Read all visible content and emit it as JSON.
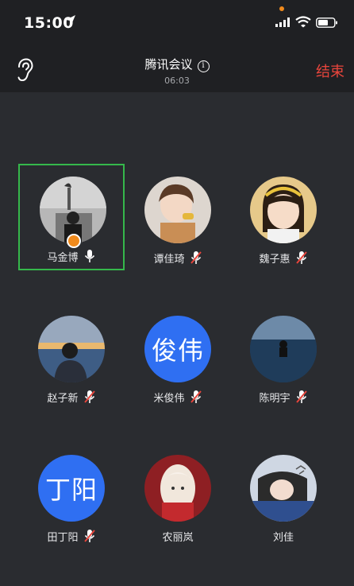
{
  "status_bar": {
    "time": "15:00"
  },
  "header": {
    "title": "腾讯会议",
    "timer": "06:03",
    "end_label": "结束"
  },
  "participants": [
    {
      "name": "马金博",
      "mic": "on",
      "host": true,
      "active": true,
      "avatar": "photo"
    },
    {
      "name": "谭佳琦",
      "mic": "muted",
      "avatar": "photo"
    },
    {
      "name": "魏子惠",
      "mic": "muted",
      "avatar": "photo"
    },
    {
      "name": "赵子新",
      "mic": "muted",
      "avatar": "photo"
    },
    {
      "name": "米俊伟",
      "mic": "muted",
      "avatar_text": "俊伟",
      "avatar_color": "#2f6ff2"
    },
    {
      "name": "陈明宇",
      "mic": "muted",
      "avatar": "photo"
    },
    {
      "name": "田丁阳",
      "mic": "muted",
      "avatar_text": "丁阳",
      "avatar_color": "#2f6ff2"
    },
    {
      "name": "农丽岚",
      "mic": "none",
      "avatar": "photo"
    },
    {
      "name": "刘佳",
      "mic": "none",
      "avatar": "photo"
    }
  ],
  "colors": {
    "accent_green": "#35b84b",
    "end_red": "#e8453c",
    "host_orange": "#f08a1c",
    "avatar_blue": "#2f6ff2"
  }
}
